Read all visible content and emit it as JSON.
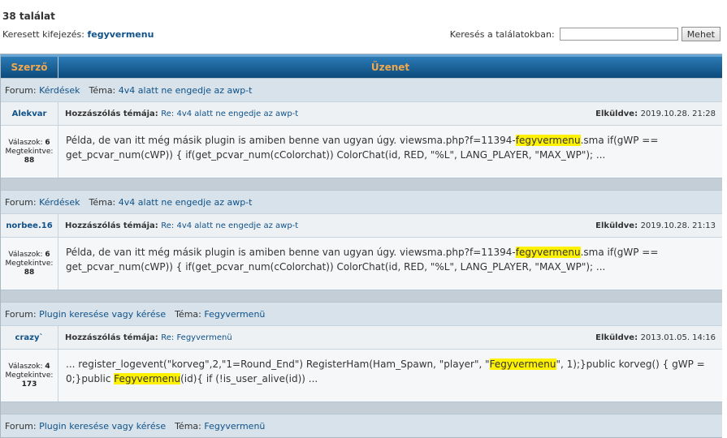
{
  "header": {
    "result_count": "38 találat",
    "searched_label": "Keresett kifejezés: ",
    "searched_term": "fegyvermenu",
    "search_in_label": "Keresés a találatokban:",
    "search_in_value": "",
    "search_button": "Mehet"
  },
  "table": {
    "col_author": "Szerző",
    "col_message": "Üzenet"
  },
  "labels": {
    "forum": "Forum: ",
    "topic": "Téma: ",
    "post_subject": "Hozzászólás témája: ",
    "sent": "Elküldve: ",
    "replies": "Válaszok: ",
    "views": "Megtekintve:"
  },
  "results": [
    {
      "forum": "Kérdések",
      "topic": "4v4 alatt ne engedje az awp-t",
      "author": "Alekvar",
      "subject": "Re: 4v4 alatt ne engedje az awp-t",
      "sent": "2019.10.28. 21:28",
      "replies": "6",
      "views": "88",
      "msg_a": "Példa, de van itt még másik plugin is amiben benne van ugyan úgy. viewsma.php?f=11394-",
      "msg_hl": "fegyvermenu",
      "msg_b": ".sma if(gWP == get_pcvar_num(cWP)) { if(get_pcvar_num(cColorchat)) ColorChat(id, RED, \"%L\", LANG_PLAYER, \"MAX_WP\"); ..."
    },
    {
      "forum": "Kérdések",
      "topic": "4v4 alatt ne engedje az awp-t",
      "author": "norbee.16",
      "subject": "Re: 4v4 alatt ne engedje az awp-t",
      "sent": "2019.10.28. 21:13",
      "replies": "6",
      "views": "88",
      "msg_a": "Példa, de van itt még másik plugin is amiben benne van ugyan úgy. viewsma.php?f=11394-",
      "msg_hl": "fegyvermenu",
      "msg_b": ".sma if(gWP == get_pcvar_num(cWP)) { if(get_pcvar_num(cColorchat)) ColorChat(id, RED, \"%L\", LANG_PLAYER, \"MAX_WP\"); ..."
    },
    {
      "forum": "Plugin keresése vagy kérése",
      "topic": "Fegyvermenü",
      "author": "crazy`",
      "subject": "Re: Fegyvermenü",
      "sent": "2013.01.05. 14:16",
      "replies": "4",
      "views": "173",
      "msg_a": "... register_logevent(\"korveg\",2,\"1=Round_End\") RegisterHam(Ham_Spawn, \"player\", \"",
      "msg_hl": "Fegyvermenu",
      "msg_b": "\", 1);}public korveg() { gWP = 0;}public ",
      "msg_hl2": "Fegyvermenu",
      "msg_c": "(id){ if (!is_user_alive(id)) ..."
    },
    {
      "forum": "Plugin keresése vagy kérése",
      "topic": "Fegyvermenü"
    }
  ]
}
